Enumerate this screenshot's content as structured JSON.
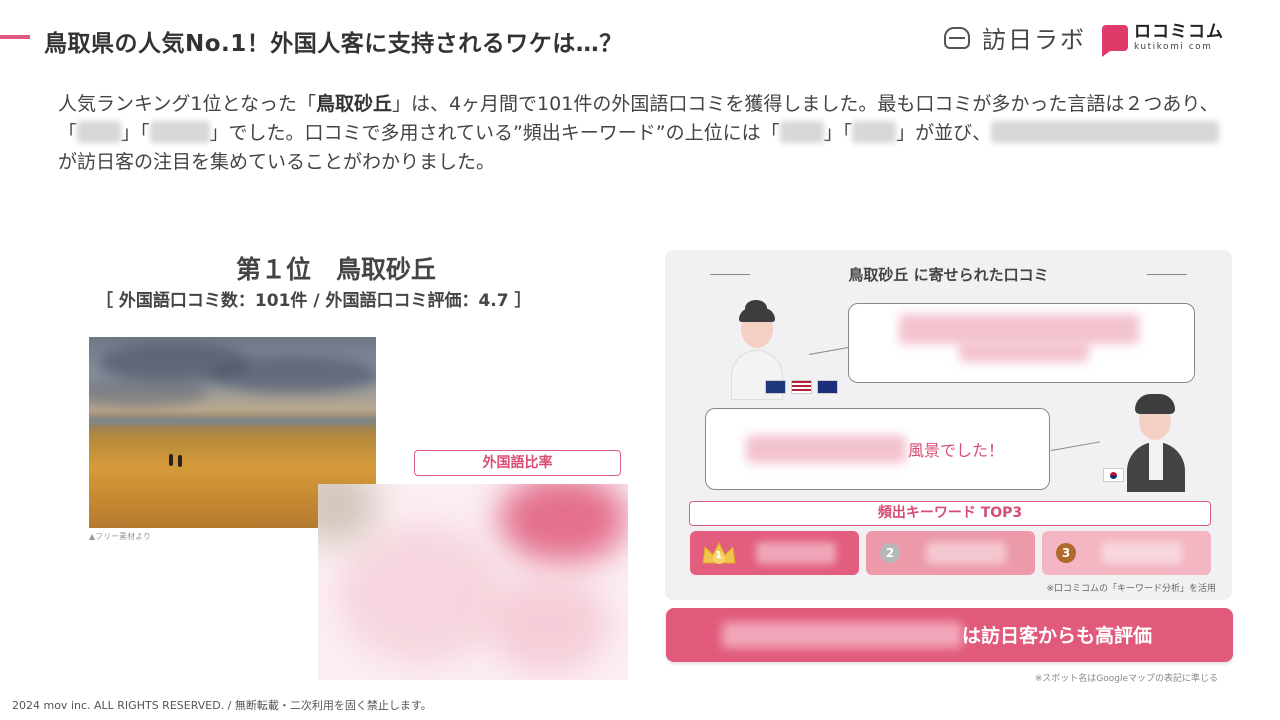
{
  "header": {
    "title": "鳥取県の人気No.1！外国人客に支持されるワケは…？",
    "brand_name": "訪日ラボ",
    "logo_jp": "ロコミコム",
    "logo_en": "kutikomi com",
    "brand_icon": "dome-icon",
    "accent_color": "#e05a7d"
  },
  "intro": {
    "p1": "人気ランキング1位となった「",
    "spot": "鳥取砂丘",
    "p2": "」は、4ヶ月間で101件の外国語口コミを獲得しました。最も口コミが多かった言語は２つあり、「",
    "p3": "」「",
    "p4": "」でした。口コミで多用されている”頻出キーワード”の上位には「",
    "p5": "」「",
    "p6": "」が並び、",
    "p7": "が訪日客の注目を集めていることがわかりました。"
  },
  "ranking": {
    "title": "第１位　鳥取砂丘",
    "subtitle": "［ 外国語口コミ数：101件 / 外国語口コミ評価：4.7 ］",
    "photo_credit": "▲フリー素材より"
  },
  "language_ratio": {
    "label": "外国語比率"
  },
  "reviews": {
    "panel_title": "鳥取砂丘 に寄せられた口コミ",
    "review2_visible_text": "風景でした！",
    "flags_review1": [
      "uk-flag-icon",
      "us-flag-icon",
      "au-flag-icon"
    ],
    "flags_review2": [
      "kr-flag-icon"
    ]
  },
  "keywords": {
    "title": "頻出キーワード TOP3",
    "ranks": [
      "1",
      "2",
      "3"
    ],
    "note": "※口コミコムの「キーワード分析」を活用",
    "rank_colors": [
      "#e35d7e",
      "#ec9aaa",
      "#f3b6c2"
    ]
  },
  "banner": {
    "text": "は訪日客からも高評価"
  },
  "notes": {
    "spot": "※スポット名はGoogleマップの表記に準じる"
  },
  "footer": {
    "copyright": "2024 mov inc. ALL RIGHTS RESERVED. / 無断転載・二次利用を固く禁止します。"
  }
}
